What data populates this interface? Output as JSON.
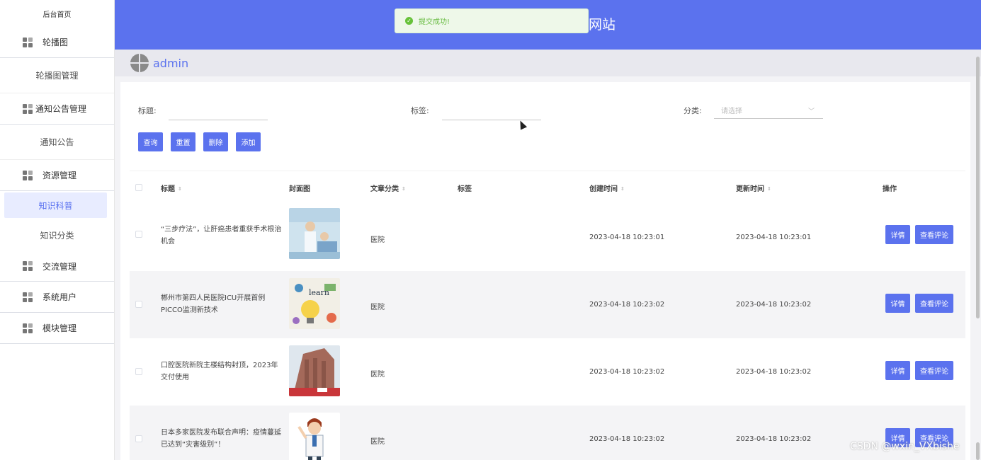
{
  "sidebar": {
    "home": "后台首页",
    "groups": [
      {
        "label": "轮播图",
        "children": [
          "轮播图管理"
        ]
      },
      {
        "label": "通知公告管理",
        "children": [
          "通知公告"
        ]
      },
      {
        "label": "资源管理",
        "children": [
          "知识科普",
          "知识分类"
        ]
      },
      {
        "label": "交流管理",
        "children": []
      },
      {
        "label": "系统用户",
        "children": []
      },
      {
        "label": "模块管理",
        "children": []
      }
    ],
    "active": "知识科普"
  },
  "header": {
    "site_title": "网站"
  },
  "toast": {
    "message": "提交成功!"
  },
  "user": {
    "name": "admin"
  },
  "filters": {
    "title_label": "标题:",
    "tag_label": "标签:",
    "category_label": "分类:",
    "category_placeholder": "请选择"
  },
  "buttons": {
    "query": "查询",
    "reset": "重置",
    "delete": "删除",
    "add": "添加"
  },
  "table": {
    "columns": [
      "标题",
      "封面图",
      "文章分类",
      "标签",
      "创建时间",
      "更新时间",
      "操作"
    ],
    "rows": [
      {
        "title": "“三步疗法”，让肝癌患者重获手术根治机会",
        "category": "医院",
        "tag": "",
        "created": "2023-04-18 10:23:01",
        "updated": "2023-04-18 10:23:01",
        "cover": "doctor-patient-photo"
      },
      {
        "title": "郴州市第四人民医院ICU开展首例PICCO监测新技术",
        "category": "医院",
        "tag": "",
        "created": "2023-04-18 10:23:02",
        "updated": "2023-04-18 10:23:02",
        "cover": "learn-bulb-illustration"
      },
      {
        "title": "口腔医院新院主楼结构封顶，2023年交付使用",
        "category": "医院",
        "tag": "",
        "created": "2023-04-18 10:23:02",
        "updated": "2023-04-18 10:23:02",
        "cover": "hospital-building-photo"
      },
      {
        "title": "日本多家医院发布联合声明：疫情蔓延已达到“灾害级别”！",
        "category": "医院",
        "tag": "",
        "created": "2023-04-18 10:23:02",
        "updated": "2023-04-18 10:23:02",
        "cover": "cartoon-doctor"
      }
    ],
    "detail_label": "详情",
    "comments_label": "查看评论"
  },
  "watermark": "CSDN @wxin_VXbishe",
  "colors": {
    "primary": "#5b72ee",
    "success": "#67c23a"
  }
}
